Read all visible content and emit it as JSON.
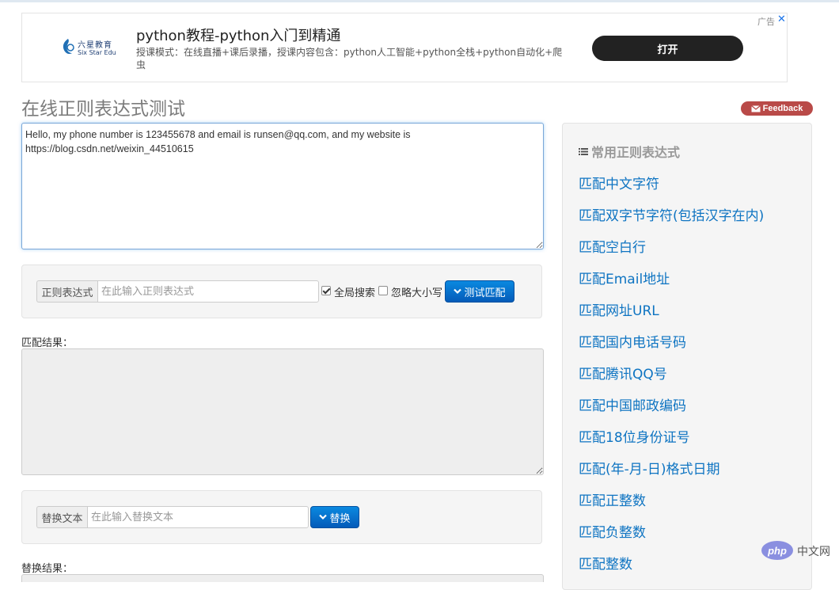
{
  "ad": {
    "logo_cn": "六星教育",
    "logo_en": "Six Star Edu",
    "title": "python教程-python入门到精通",
    "description": "授课模式：在线直播+课后录播，授课内容包含：python人工智能+python全栈+python自动化+爬虫",
    "open_label": "打开",
    "tag": "广告",
    "close_glyph": "✕"
  },
  "page": {
    "title": "在线正则表达式测试",
    "feedback_label": "Feedback"
  },
  "source": {
    "text": "Hello, my phone number is 123455678 and email is runsen@qq.com, and my website is https://blog.csdn.net/weixin_44510615"
  },
  "regex": {
    "addon_label": "正则表达式",
    "placeholder": "在此输入正则表达式",
    "value": "",
    "global_label": "全局搜索",
    "global_checked": true,
    "ignorecase_label": "忽略大小写",
    "ignorecase_checked": false,
    "test_button": "测试匹配"
  },
  "match": {
    "label": "匹配结果："
  },
  "replace": {
    "addon_label": "替换文本",
    "placeholder": "在此输入替换文本",
    "value": "",
    "button": "替换"
  },
  "replace_result": {
    "label": "替换结果："
  },
  "sidebar": {
    "title": "常用正则表达式",
    "items": [
      "匹配中文字符",
      "匹配双字节字符(包括汉字在内)",
      "匹配空白行",
      "匹配Email地址",
      "匹配网址URL",
      "匹配国内电话号码",
      "匹配腾讯QQ号",
      "匹配中国邮政编码",
      "匹配18位身份证号",
      "匹配(年-月-日)格式日期",
      "匹配正整数",
      "匹配负整数",
      "匹配整数"
    ]
  },
  "watermark": {
    "logo": "php",
    "text": "中文网"
  },
  "colors": {
    "link": "#0e74c2",
    "button_blue": "#0a6fd1",
    "feedback_red": "#b94a48",
    "ad_button": "#222222"
  }
}
